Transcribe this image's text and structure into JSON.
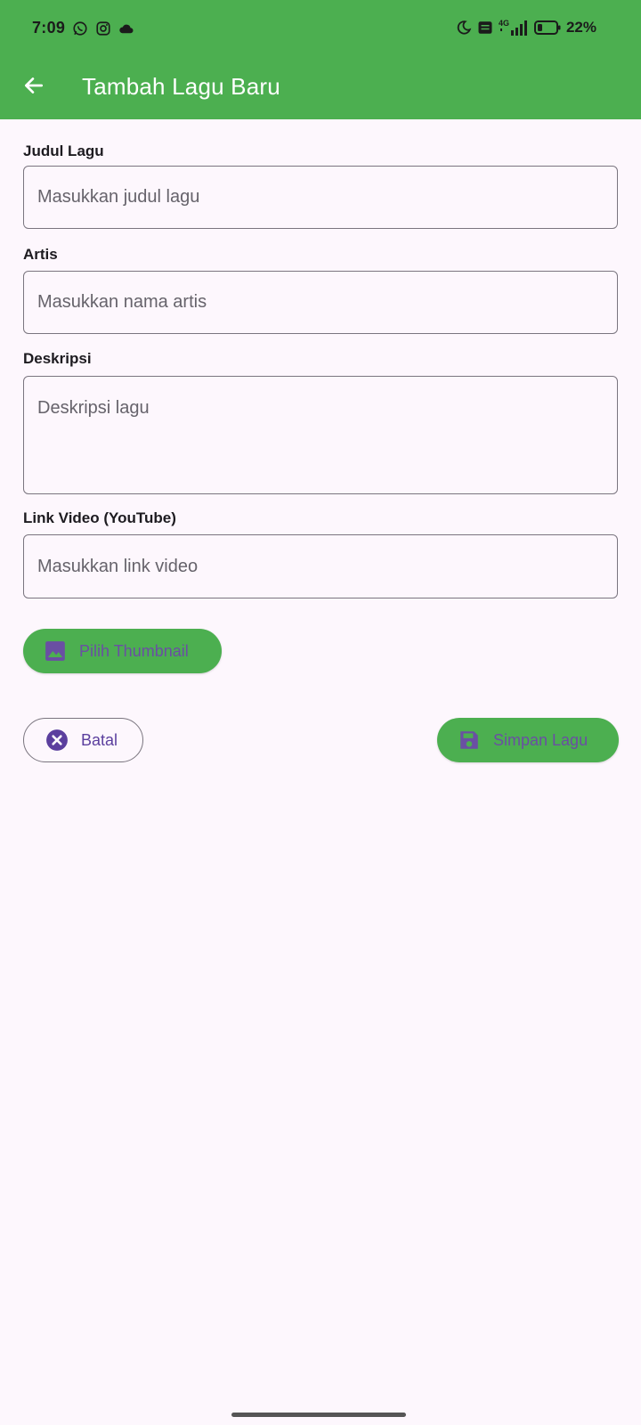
{
  "status_bar": {
    "time": "7:09",
    "battery": "22%",
    "network": "4G",
    "icons_left": [
      "whatsapp-icon",
      "instagram-icon",
      "cloud-icon"
    ],
    "icons_right": [
      "moon-icon",
      "volte-icon",
      "signal-icon",
      "battery-icon"
    ]
  },
  "app_bar": {
    "title": "Tambah Lagu Baru",
    "back_icon": "arrow-left-icon",
    "color": "#4caf50"
  },
  "form": {
    "title_label": "Judul Lagu",
    "title_placeholder": "Masukkan judul lagu",
    "title_value": "",
    "artist_label": "Artis",
    "artist_placeholder": "Masukkan nama artis",
    "artist_value": "",
    "description_label": "Deskripsi",
    "description_placeholder": "Deskripsi lagu",
    "description_value": "",
    "video_label": "Link Video (YouTube)",
    "video_placeholder": "Masukkan link video",
    "video_value": ""
  },
  "buttons": {
    "thumbnail": "Pilih Thumbnail",
    "cancel": "Batal",
    "save": "Simpan Lagu"
  },
  "colors": {
    "primary": "#4caf50",
    "accent_purple": "#6a4fa3",
    "background": "#fdf7fd",
    "outline": "#7a757f"
  }
}
